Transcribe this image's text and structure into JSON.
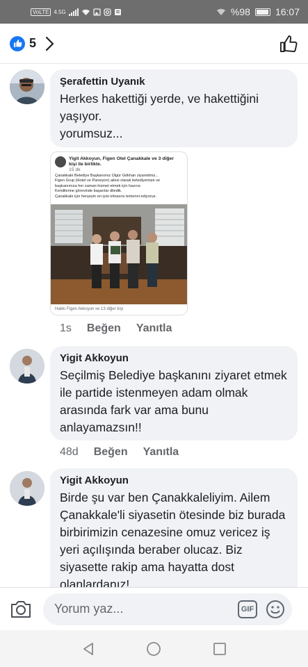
{
  "status_bar": {
    "carrier": "VoLTE",
    "network": "4.5G",
    "battery": "%98",
    "battery_level": 0.98,
    "time": "16:07"
  },
  "header": {
    "like_count": "5",
    "like_icon": "thumbs-up-icon",
    "chevron_icon": "chevron-right-icon"
  },
  "comments": [
    {
      "author": "Şerafettin Uyanık",
      "text": "Herkes hakettiği yerde, ve hakettiğini yaşıyor.\nyorumsuz...",
      "time": "1s",
      "like_label": "Beğen",
      "reply_label": "Yanıtla",
      "shared_post": {
        "header": "Yigit Akkoyun, Figen Otel Çanakkale ve 3 diğer kişi ile birlikte.",
        "time": "15 dk",
        "text": "Çanakkale Belediye Başkanımız Ülgür Gökhan ziyaretimiz...\nFigen Grup (Hotel ve Pansiyon) ailesi olarak belediyemize ve başkanımıza her zaman hizmet etmek için hazırız.\nKendilerine görevinde başarılar diledik.\nÇanakkale için herşeyin en iyisi olmasını temenni ediyoruz.",
        "footer": "Hakkı Figen Akkoyun ve 13 diğer kişi"
      }
    },
    {
      "author": "Yigit Akkoyun",
      "text": "Seçilmiş Belediye başkanını ziyaret etmek ile partide istenmeyen adam olmak arasında fark var ama bunu anlayamazsın!!",
      "time": "48d",
      "like_label": "Beğen",
      "reply_label": "Yanıtla"
    },
    {
      "author": "Yigit Akkoyun",
      "text": "Birde şu var ben Çanakkaleliyim. Ailem Çanakkale'li siyasetin ötesinde biz burada birbirimizin cenazesine omuz vericez iş yeri açılışında beraber olucaz. Biz siyasette rakip ama hayatta dost olanlardanız!"
    }
  ],
  "composer": {
    "placeholder": "Yorum yaz...",
    "gif_label": "GIF",
    "camera_icon": "camera-icon",
    "emoji_icon": "smiley-icon"
  },
  "nav": {
    "back_icon": "back-triangle-icon",
    "home_icon": "home-circle-icon",
    "recent_icon": "recent-square-icon"
  },
  "colors": {
    "accent": "#1877f2",
    "bubble": "#f0f2f5",
    "meta_text": "#65676b",
    "status_bar": "#6e6e6e"
  }
}
